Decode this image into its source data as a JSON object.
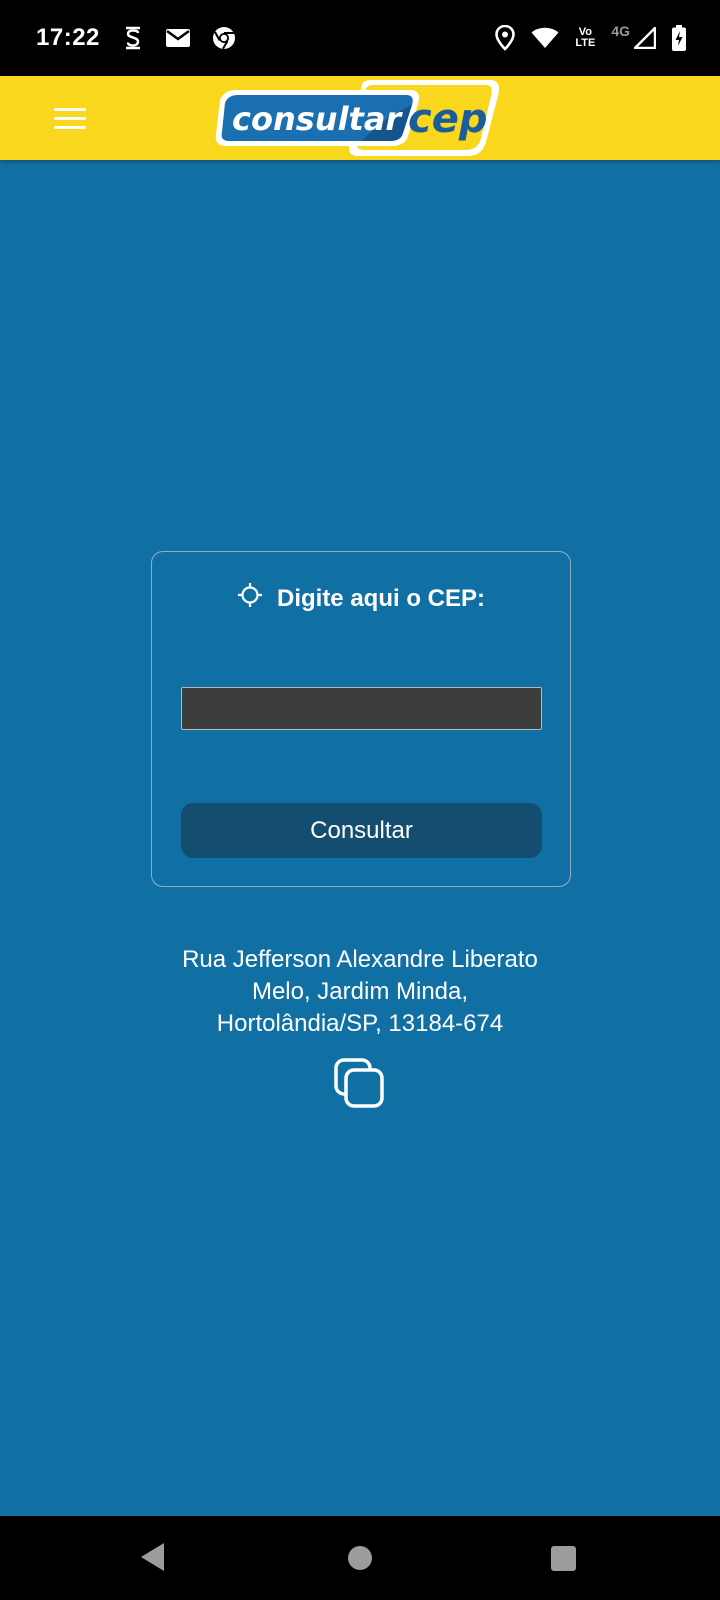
{
  "status_bar": {
    "time": "17:22",
    "left_icons": [
      "s-app-icon",
      "gmail-icon",
      "chrome-icon"
    ],
    "right_icons": [
      "location-icon",
      "wifi-icon",
      "volte-icon",
      "signal-icon",
      "battery-charging-icon"
    ],
    "volte_line1": "Vo",
    "volte_line2": "LTE",
    "network_type": "4G"
  },
  "app_bar": {
    "logo_part1": "consultar",
    "logo_part2": "cep",
    "colors": {
      "background": "#f9d71c",
      "logo_blue": "#1a6fb1",
      "logo_dark": "#0f3f6e"
    }
  },
  "card": {
    "title": "Digite aqui o CEP:",
    "input_value": "",
    "input_placeholder": "",
    "button_label": "Consultar"
  },
  "result": {
    "address_line1": "Rua Jefferson Alexandre Liberato",
    "address_line2": "Melo, Jardim Minda,",
    "address_line3": "Hortolândia/SP, 13184-674"
  },
  "colors": {
    "page_background": "#1170a3",
    "button_background": "#134e70",
    "input_background": "#3d3d3d"
  }
}
